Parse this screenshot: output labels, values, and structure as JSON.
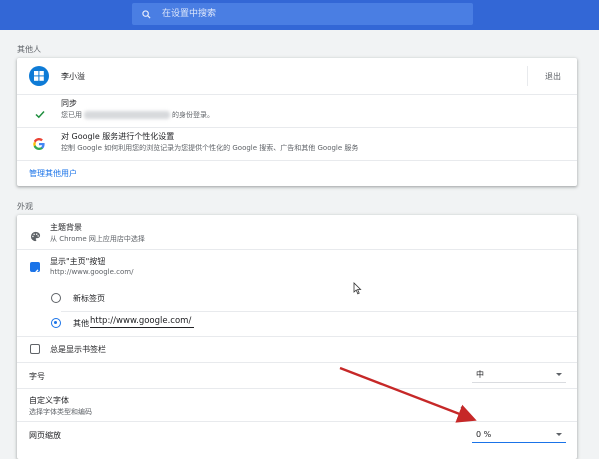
{
  "search": {
    "placeholder": "在设置中搜索"
  },
  "people": {
    "section_title": "其他人",
    "user_name": "李小溢",
    "signout_label": "退出",
    "sync_title": "同步",
    "sync_prefix": "您已用",
    "sync_suffix": "的身份登录。",
    "personalize_title": "对 Google 服务进行个性化设置",
    "personalize_desc": "控制 Google 如何利用您的浏览记录为您提供个性化的 Google 搜索、广告和其他 Google 服务",
    "manage_link": "管理其他用户"
  },
  "appearance": {
    "section_title": "外观",
    "theme_title": "主题背景",
    "theme_desc": "从 Chrome 网上应用店中选择",
    "home_button_title": "显示\"主页\"按钮",
    "home_button_url": "http://www.google.com/",
    "home_button_checked": true,
    "newtab_label": "新标签页",
    "other_label": "其他",
    "other_url_value": "http://www.google.com/",
    "bookmarks_label": "总是显示书签栏",
    "bookmarks_checked": false,
    "font_size_label": "字号",
    "font_size_value": "中",
    "custom_fonts_title": "自定义字体",
    "custom_fonts_desc": "选择字体类型和编码",
    "zoom_label": "网页缩放",
    "zoom_value": "0  %"
  },
  "colors": {
    "accent": "#1a73e8",
    "topbar": "#3367d6",
    "annotation_arrow": "#c62828"
  },
  "icons": [
    "search-icon",
    "windows-avatar-icon",
    "check-icon",
    "google-g-icon",
    "palette-icon",
    "mouse-cursor-icon",
    "red-arrow-annotation"
  ]
}
